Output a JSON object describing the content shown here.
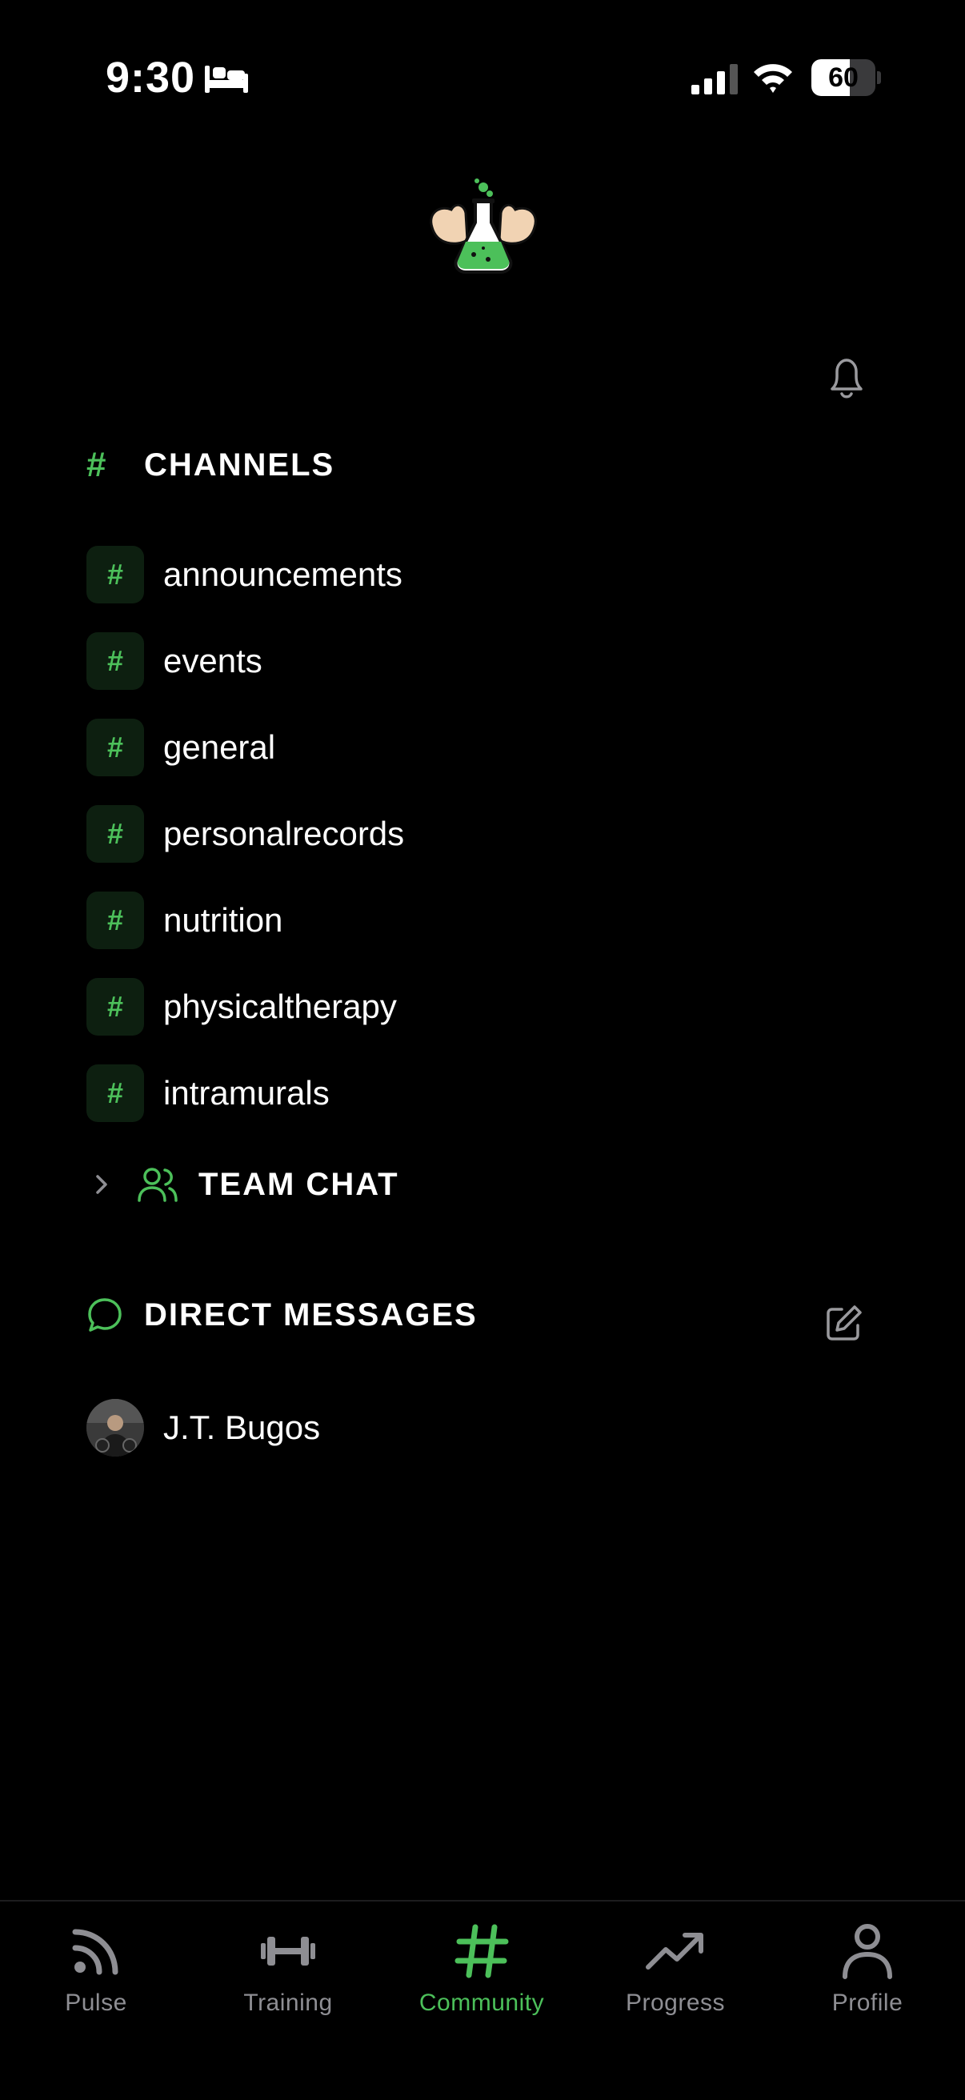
{
  "status_bar": {
    "time": "9:30",
    "battery": "60",
    "battery_level": 0.6
  },
  "channels": {
    "title": "CHANNELS",
    "items": [
      {
        "label": "announcements"
      },
      {
        "label": "events"
      },
      {
        "label": "general"
      },
      {
        "label": "personalrecords"
      },
      {
        "label": "nutrition"
      },
      {
        "label": "physicaltherapy"
      },
      {
        "label": "intramurals"
      }
    ]
  },
  "team_chat": {
    "title": "TEAM CHAT"
  },
  "direct_messages": {
    "title": "DIRECT MESSAGES",
    "items": [
      {
        "name": "J.T. Bugos"
      }
    ]
  },
  "tab_bar": {
    "tabs": [
      {
        "label": "Pulse",
        "icon": "rss-icon"
      },
      {
        "label": "Training",
        "icon": "dumbbell-icon"
      },
      {
        "label": "Community",
        "icon": "hash-icon",
        "active": true
      },
      {
        "label": "Progress",
        "icon": "trend-up-icon"
      },
      {
        "label": "Profile",
        "icon": "person-icon"
      }
    ]
  },
  "colors": {
    "accent": "#4cc05a",
    "background": "#000000",
    "inactive": "#8e8e93",
    "badge_bg": "#0d1f10"
  }
}
